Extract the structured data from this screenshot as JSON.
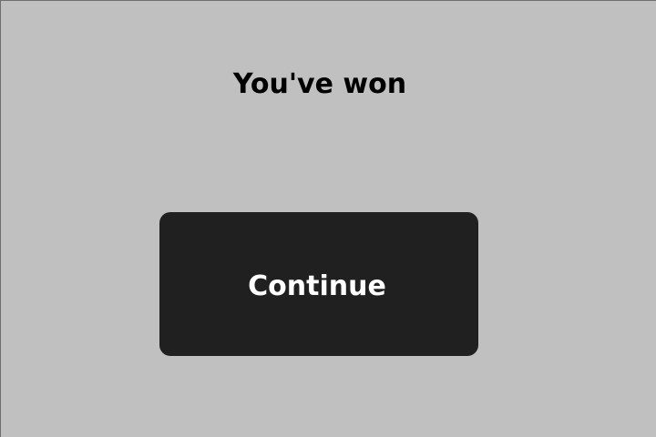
{
  "dialog": {
    "title": "You've won",
    "continue_label": "Continue"
  },
  "colors": {
    "background": "#c0c0c0",
    "button": "#202020",
    "button_text": "#ffffff",
    "title_text": "#000000"
  }
}
